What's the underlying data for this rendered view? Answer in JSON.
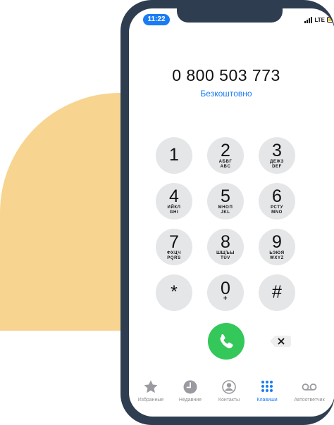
{
  "status_bar": {
    "time": "11:22",
    "network": "LTE"
  },
  "dialer": {
    "number": "0 800 503 773",
    "label": "Безкоштовно",
    "keys": [
      {
        "digit": "1",
        "letters": ""
      },
      {
        "digit": "2",
        "letters_cyr": "АБВГ",
        "letters_lat": "ABC"
      },
      {
        "digit": "3",
        "letters_cyr": "ДЕЖЗ",
        "letters_lat": "DEF"
      },
      {
        "digit": "4",
        "letters_cyr": "ИЙКЛ",
        "letters_lat": "GHI"
      },
      {
        "digit": "5",
        "letters_cyr": "МНОП",
        "letters_lat": "JKL"
      },
      {
        "digit": "6",
        "letters_cyr": "РСТУ",
        "letters_lat": "MNO"
      },
      {
        "digit": "7",
        "letters_cyr": "ФХЦЧ",
        "letters_lat": "PQRS"
      },
      {
        "digit": "8",
        "letters_cyr": "ШЩЪЫ",
        "letters_lat": "TUV"
      },
      {
        "digit": "9",
        "letters_cyr": "ЬЭЮЯ",
        "letters_lat": "WXYZ"
      },
      {
        "digit": "*",
        "letters": ""
      },
      {
        "digit": "0",
        "letters": "+"
      },
      {
        "digit": "#",
        "letters": ""
      }
    ]
  },
  "tabs": [
    {
      "label": "Избранные",
      "icon": "star-icon"
    },
    {
      "label": "Недавние",
      "icon": "clock-icon"
    },
    {
      "label": "Контакты",
      "icon": "person-circle-icon"
    },
    {
      "label": "Клавиши",
      "icon": "keypad-icon",
      "active": true
    },
    {
      "label": "Автоответчик",
      "icon": "voicemail-icon"
    }
  ],
  "colors": {
    "accent": "#1a7bf3",
    "call_green": "#34c759",
    "frame": "#2e3d50",
    "decor": "#f7d590",
    "key_bg": "#e5e6e7"
  }
}
